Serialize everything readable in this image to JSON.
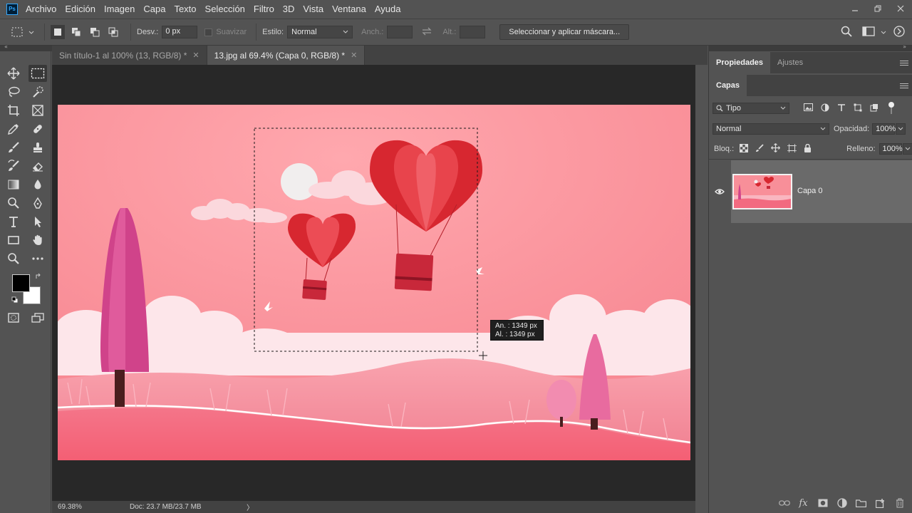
{
  "menu": [
    "Archivo",
    "Edición",
    "Imagen",
    "Capa",
    "Texto",
    "Selección",
    "Filtro",
    "3D",
    "Vista",
    "Ventana",
    "Ayuda"
  ],
  "app_logo": "Ps",
  "options": {
    "feather_label": "Desv.:",
    "feather_value": "0 px",
    "antialias_label": "Suavizar",
    "style_label": "Estilo:",
    "style_value": "Normal",
    "width_label": "Anch.:",
    "height_label": "Alt.:",
    "mask_button": "Seleccionar y aplicar máscara..."
  },
  "tabs": [
    {
      "title": "Sin título-1 al 100% (13, RGB/8) *"
    },
    {
      "title": "13.jpg al 69.4% (Capa 0, RGB/8) *"
    }
  ],
  "active_tab": 1,
  "tooltip": {
    "width_line": "An. :  1349 px",
    "height_line": "Al. :  1349 px"
  },
  "status": {
    "zoom": "69.38%",
    "doc": "Doc: 23.7 MB/23.7 MB",
    "arrow": "〉"
  },
  "panels": {
    "top_tabs": [
      "Propiedades",
      "Ajustes"
    ],
    "layers_tab": "Capas",
    "filter_kind": "Tipo",
    "blend_mode": "Normal",
    "opacity_label": "Opacidad:",
    "opacity_value": "100%",
    "lock_label": "Bloq.:",
    "fill_label": "Relleno:",
    "fill_value": "100%",
    "layer_name": "Capa 0"
  },
  "colors": {
    "foreground": "#000000",
    "background": "#ffffff",
    "accent": "#31a8ff"
  }
}
